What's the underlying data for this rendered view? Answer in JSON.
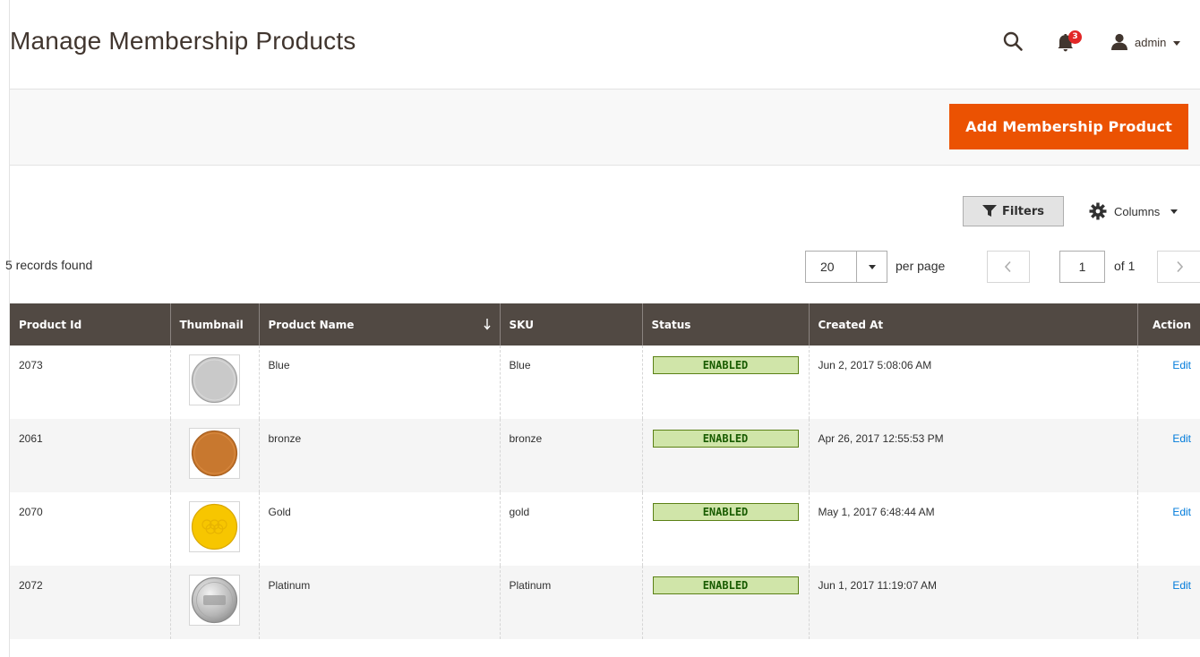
{
  "header": {
    "title": "Manage Membership Products",
    "notifications_count": "3",
    "user_name": "admin"
  },
  "actions": {
    "add_button_label": "Add Membership Product"
  },
  "toolbar": {
    "filters_label": "Filters",
    "columns_label": "Columns",
    "records_found": "5 records found",
    "per_page_value": "20",
    "per_page_label": "per page",
    "current_page": "1",
    "page_of": "of 1"
  },
  "table": {
    "columns": [
      "Product Id",
      "Thumbnail",
      "Product Name",
      "SKU",
      "Status",
      "Created At",
      "Action"
    ],
    "rows": [
      {
        "id": "2073",
        "name": "Blue",
        "sku": "Blue",
        "status": "ENABLED",
        "created_at": "Jun 2, 2017 5:08:06 AM",
        "action": "Edit",
        "thumb": "silver-medal"
      },
      {
        "id": "2061",
        "name": "bronze",
        "sku": "bronze",
        "status": "ENABLED",
        "created_at": "Apr 26, 2017 12:55:53 PM",
        "action": "Edit",
        "thumb": "bronze-medal"
      },
      {
        "id": "2070",
        "name": "Gold",
        "sku": "gold",
        "status": "ENABLED",
        "created_at": "May 1, 2017 6:48:44 AM",
        "action": "Edit",
        "thumb": "gold-medal"
      },
      {
        "id": "2072",
        "name": "Platinum",
        "sku": "Platinum",
        "status": "ENABLED",
        "created_at": "Jun 1, 2017 11:19:07 AM",
        "action": "Edit",
        "thumb": "platinum-medal"
      }
    ]
  },
  "colors": {
    "accent": "#eb5202",
    "table_header": "#514943",
    "link": "#007bdb",
    "badge_bg": "#d0e5a9",
    "badge_text": "#185b00",
    "notification": "#e22626"
  },
  "icons": {
    "search": "search-icon",
    "notifications": "bell-icon",
    "user": "user-icon",
    "filters": "funnel-icon",
    "columns": "gear-icon"
  }
}
